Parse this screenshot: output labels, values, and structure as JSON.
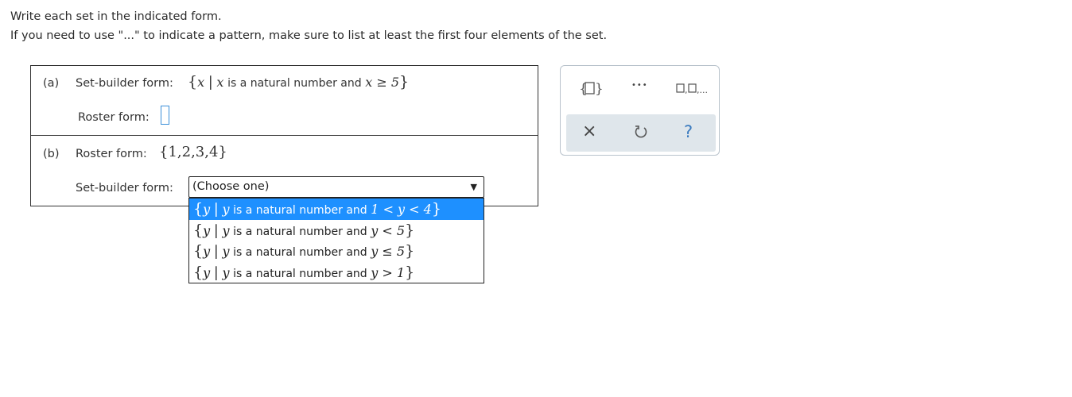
{
  "instructions": {
    "line1": "Write each set in the indicated form.",
    "line2": "If you need to use \"...\" to indicate a pattern, make sure to list at least the first four elements of the set."
  },
  "part_a": {
    "tag": "(a)",
    "setbuilder_label": "Set-builder form:",
    "set_var": "x",
    "set_cond_text": "is a natural number and",
    "set_expr": "x ≥ 5",
    "roster_label": "Roster form:",
    "roster_value": ""
  },
  "part_b": {
    "tag": "(b)",
    "roster_label": "Roster form:",
    "roster_set": "{1,2,3,4}",
    "setbuilder_label": "Set-builder form:",
    "select_value": "(Choose one)",
    "options": [
      {
        "var": "y",
        "text": "is a natural number and",
        "expr": "1 < y < 4"
      },
      {
        "var": "y",
        "text": "is a natural number and",
        "expr": "y < 5"
      },
      {
        "var": "y",
        "text": "is a natural number and",
        "expr": "y ≤ 5"
      },
      {
        "var": "y",
        "text": "is a natural number and",
        "expr": "y > 1"
      }
    ]
  },
  "palette": {
    "set_braces": "{□}",
    "ellipsis": "•••",
    "list": "□,□,...",
    "clear": "×",
    "undo": "↺",
    "help": "?"
  }
}
